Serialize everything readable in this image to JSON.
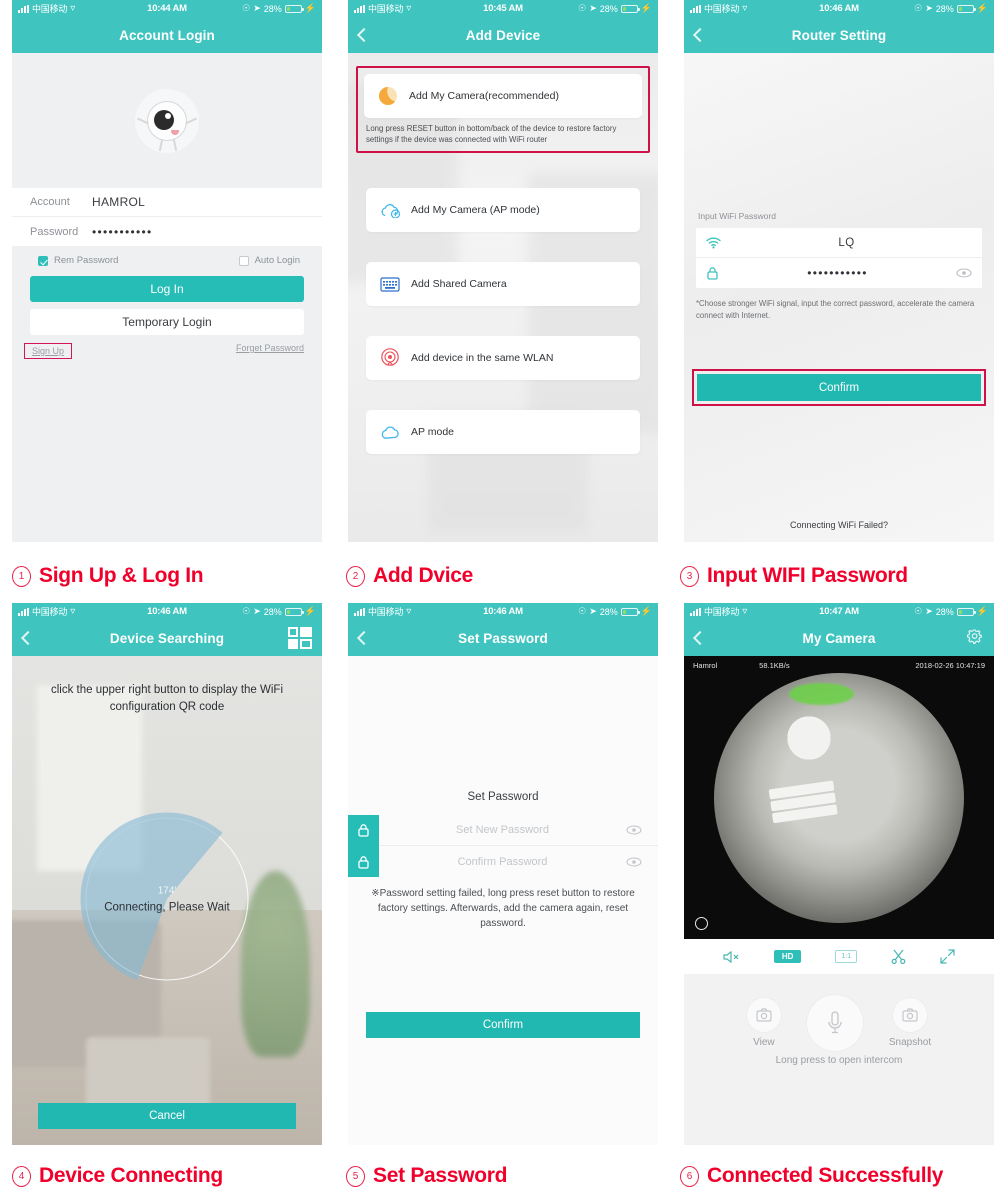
{
  "panels": [
    {
      "id": "login",
      "status": {
        "carrier": "中国移动",
        "time": "10:44 AM",
        "battery": "28%"
      },
      "nav": {
        "title": "Account Login"
      },
      "form": {
        "account_label": "Account",
        "account_value": "HAMROL",
        "password_label": "Password",
        "password_value": "•••••••••••"
      },
      "options": {
        "rem_password": "Rem Password",
        "auto_login": "Auto Login"
      },
      "buttons": {
        "login": "Log In",
        "temporary": "Temporary Login"
      },
      "links": {
        "sign_up": "Sign Up",
        "forget": "Forget Password"
      }
    },
    {
      "id": "add-device",
      "status": {
        "carrier": "中国移动",
        "time": "10:45 AM",
        "battery": "28%"
      },
      "nav": {
        "title": "Add Device"
      },
      "highlight_card": {
        "label": "Add My Camera(recommended)",
        "note": "Long press RESET button in bottom/back of the device to restore factory settings if the device was connected with WiFi router"
      },
      "items": [
        {
          "label": "Add My Camera (AP mode)",
          "icon": "cloud-plus-icon"
        },
        {
          "label": "Add Shared Camera",
          "icon": "keyboard-icon"
        },
        {
          "label": "Add device in the same WLAN",
          "icon": "wlan-signal-icon"
        },
        {
          "label": "AP mode",
          "icon": "cloud-icon"
        }
      ]
    },
    {
      "id": "router-setting",
      "status": {
        "carrier": "中国移动",
        "time": "10:46 AM",
        "battery": "28%"
      },
      "nav": {
        "title": "Router Setting"
      },
      "input_label": "Input WiFi Password",
      "ssid_value": "LQ",
      "password_value": "•••••••••••",
      "tip": "*Choose stronger WiFi signal, input the correct password, accelerate the camera connect with Internet.",
      "confirm": "Confirm",
      "footer_link": "Connecting WiFi Failed?"
    },
    {
      "id": "device-searching",
      "status": {
        "carrier": "中国移动",
        "time": "10:46 AM",
        "battery": "28%"
      },
      "nav": {
        "title": "Device Searching",
        "right_icon": "qr-code-icon"
      },
      "instruction": "click the upper right button to display the WiFi configuration QR code",
      "timer": "174'",
      "waiting": "Connecting, Please Wait",
      "cancel": "Cancel"
    },
    {
      "id": "set-password",
      "status": {
        "carrier": "中国移动",
        "time": "10:46 AM",
        "battery": "28%"
      },
      "nav": {
        "title": "Set Password"
      },
      "section_title": "Set Password",
      "fields": [
        {
          "placeholder": "Set New Password",
          "icon": "lock-icon",
          "eye": "eye-icon"
        },
        {
          "placeholder": "Confirm Password",
          "icon": "lock-icon",
          "eye": "eye-icon"
        }
      ],
      "note": "※Password setting failed, long press reset button to restore factory settings. Afterwards, add the camera again, reset password.",
      "confirm": "Confirm"
    },
    {
      "id": "my-camera",
      "status": {
        "carrier": "中国移动",
        "time": "10:47 AM",
        "battery": "28%"
      },
      "nav": {
        "title": "My Camera",
        "right_icon": "gear-icon"
      },
      "overlay": {
        "device_name": "Hamrol",
        "bitrate": "58.1KB/s",
        "timestamp": "2018-02-26 10:47:19"
      },
      "controls": [
        {
          "name": "mute-icon",
          "label": ""
        },
        {
          "name": "hd-badge",
          "label": "HD"
        },
        {
          "name": "aspect-ratio-badge",
          "label": "1:1"
        },
        {
          "name": "scissors-icon",
          "label": ""
        },
        {
          "name": "fullscreen-icon",
          "label": ""
        }
      ],
      "actions": {
        "view": "View",
        "snapshot": "Snapshot",
        "intercom_hint": "Long press to open intercom"
      }
    }
  ],
  "captions": [
    {
      "num": "1",
      "text": "Sign Up & Log In"
    },
    {
      "num": "2",
      "text": "Add Dvice"
    },
    {
      "num": "3",
      "text": "Input WIFI Password"
    },
    {
      "num": "4",
      "text": "Device Connecting"
    },
    {
      "num": "5",
      "text": "Set Password"
    },
    {
      "num": "6",
      "text": "Connected Successfully"
    }
  ],
  "colors": {
    "teal": "#3fc4bf",
    "button_teal": "#22b8b2",
    "caption_red": "#f0002a",
    "highlight_red": "#cf1148"
  }
}
